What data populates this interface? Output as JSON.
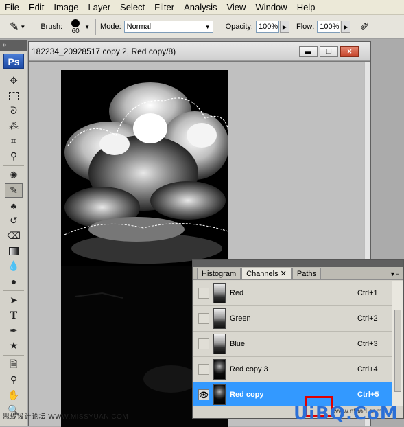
{
  "menu": {
    "items": [
      "File",
      "Edit",
      "Image",
      "Layer",
      "Select",
      "Filter",
      "Analysis",
      "View",
      "Window",
      "Help"
    ]
  },
  "options": {
    "brush_label": "Brush:",
    "brush_size": "60",
    "mode_label": "Mode:",
    "mode_value": "Normal",
    "opacity_label": "Opacity:",
    "opacity_value": "100%",
    "flow_label": "Flow:",
    "flow_value": "100%"
  },
  "toolbar": {
    "logo": "Ps"
  },
  "document": {
    "title": "182234_20928517 copy 2, Red copy/8)"
  },
  "channels_panel": {
    "tabs": [
      "Histogram",
      "Channels",
      "Paths"
    ],
    "active_tab": "Channels",
    "rows": [
      {
        "name": "Red",
        "shortcut": "Ctrl+1",
        "visible": false,
        "selected": false
      },
      {
        "name": "Green",
        "shortcut": "Ctrl+2",
        "visible": false,
        "selected": false
      },
      {
        "name": "Blue",
        "shortcut": "Ctrl+3",
        "visible": false,
        "selected": false
      },
      {
        "name": "Red copy 3",
        "shortcut": "Ctrl+4",
        "visible": false,
        "selected": false
      },
      {
        "name": "Red copy",
        "shortcut": "Ctrl+5",
        "visible": true,
        "selected": true
      }
    ]
  },
  "watermark": {
    "left": "思缘设计论坛 WWW.MISSYUAN.COM",
    "right": "UiBQ.CoM",
    "url": "www.ntoad.com"
  },
  "colors": {
    "selection": "#3399ff",
    "highlight_box": "#e00000"
  }
}
